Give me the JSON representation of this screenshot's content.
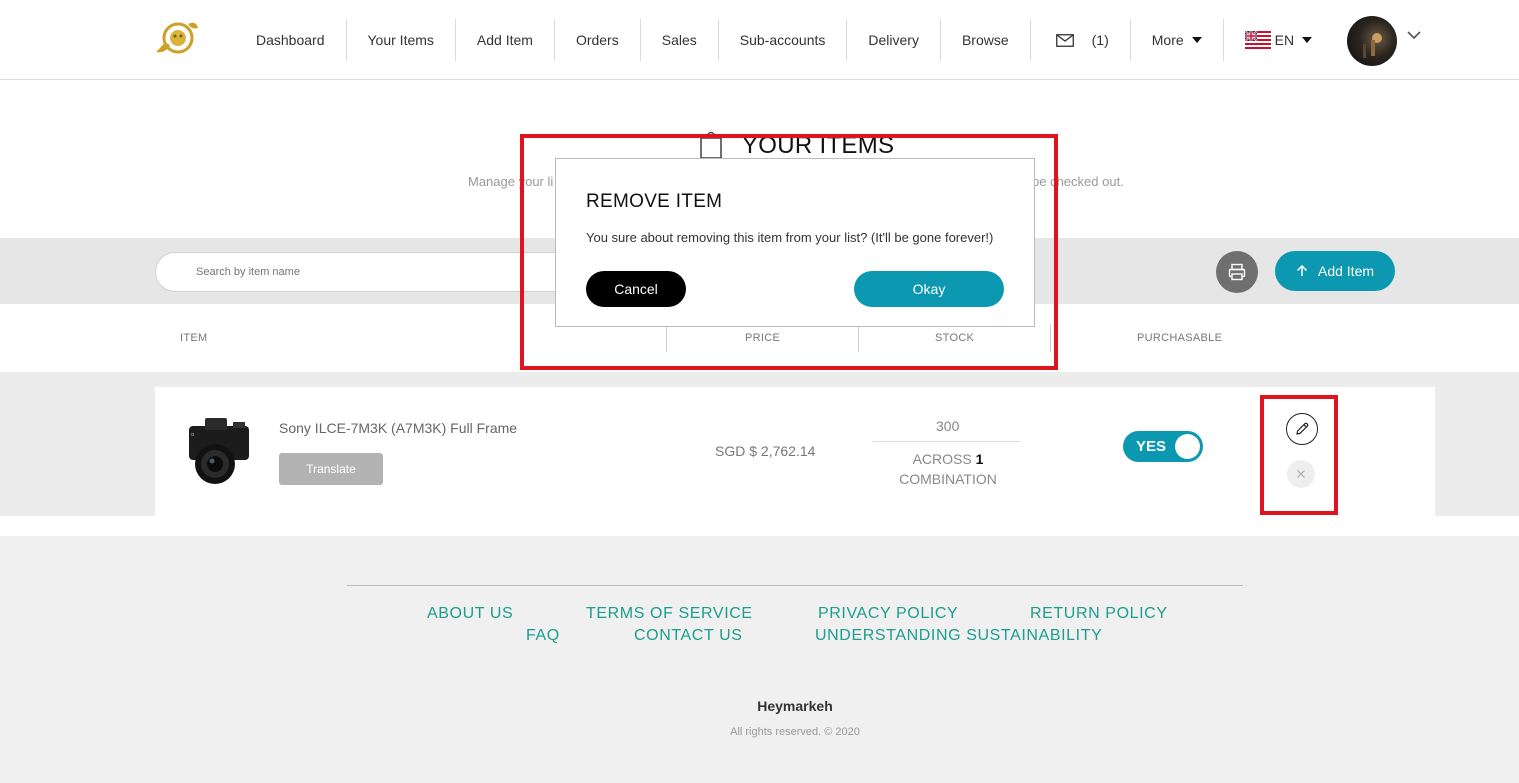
{
  "header": {
    "nav": [
      "Dashboard",
      "Your Items",
      "Add Item",
      "Orders",
      "Sales",
      "Sub-accounts",
      "Delivery",
      "Browse"
    ],
    "mail_count": "(1)",
    "more_label": "More",
    "language": "EN"
  },
  "page": {
    "title": "YOUR ITEMS",
    "subtitle_left": "Manage your li",
    "subtitle_right": "be checked out."
  },
  "toolbar": {
    "search_placeholder": "Search by item name",
    "add_item_label": "Add Item"
  },
  "columns": {
    "item": "ITEM",
    "price": "PRICE",
    "stock": "STOCK",
    "purchasable": "PURCHASABLE"
  },
  "item": {
    "name": "Sony ILCE-7M3K (A7M3K) Full Frame",
    "translate_label": "Translate",
    "price": "SGD $ 2,762.14",
    "stock": "300",
    "across_prefix": "ACROSS",
    "across_count": "1",
    "across_suffix": "COMBINATION",
    "purchasable": "YES"
  },
  "modal": {
    "title": "REMOVE ITEM",
    "body": "You sure about removing this item from your list? (It'll be gone forever!)",
    "cancel_label": "Cancel",
    "okay_label": "Okay"
  },
  "footer": {
    "links": {
      "about": "ABOUT US",
      "terms": "TERMS OF SERVICE",
      "privacy": "PRIVACY POLICY",
      "return": "RETURN POLICY",
      "faq": "FAQ",
      "contact": "CONTACT US",
      "sustainability": "UNDERSTANDING SUSTAINABILITY"
    },
    "brand": "Heymarkeh",
    "copyright": "All rights reserved. © 2020"
  },
  "colors": {
    "accent": "#0b98b0",
    "highlight": "#e0141e",
    "footer_link": "#1b9e8e"
  },
  "icons": [
    "lion-logo-icon",
    "mail-icon",
    "caret-down-icon",
    "us-uk-flag-icon",
    "chevron-down-icon",
    "bag-icon",
    "search-icon",
    "print-icon",
    "arrow-up-icon",
    "camera-image",
    "pencil-icon",
    "close-icon"
  ]
}
